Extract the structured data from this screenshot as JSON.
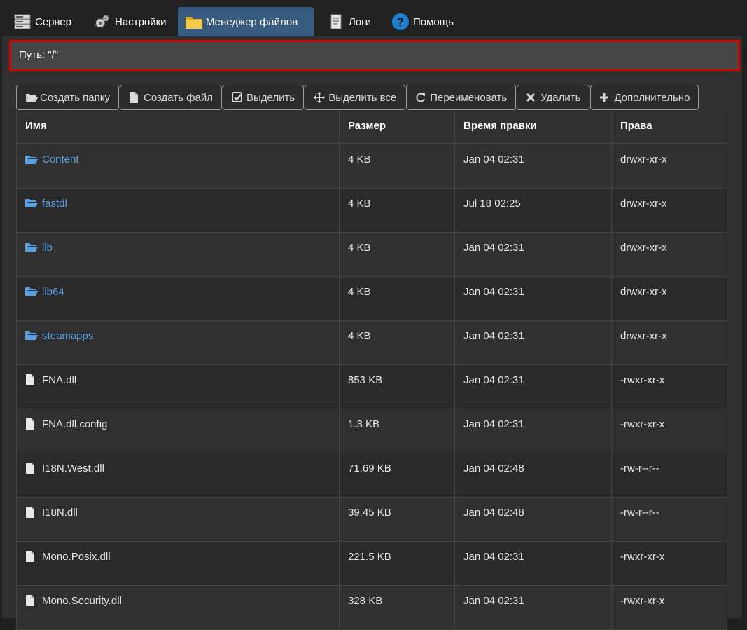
{
  "nav": {
    "tabs": [
      {
        "label": "Сервер",
        "icon": "server-icon",
        "active": false
      },
      {
        "label": "Настройки",
        "icon": "gears-icon",
        "active": false
      },
      {
        "label": "Менеджер файлов",
        "icon": "folder-icon",
        "active": true
      },
      {
        "label": "Логи",
        "icon": "log-document-icon",
        "active": false
      },
      {
        "label": "Помощь",
        "icon": "help-icon",
        "active": false
      }
    ]
  },
  "path": {
    "text": "Путь: \"/\""
  },
  "toolbar": {
    "buttons": [
      {
        "label": "Создать папку",
        "icon": "folder-open-icon"
      },
      {
        "label": "Создать файл",
        "icon": "file-icon"
      },
      {
        "label": "Выделить",
        "icon": "check-square-icon"
      },
      {
        "label": "Выделить все",
        "icon": "move-arrows-icon"
      },
      {
        "label": "Переименовать",
        "icon": "refresh-icon"
      },
      {
        "label": "Удалить",
        "icon": "close-icon"
      },
      {
        "label": "Дополнительно",
        "icon": "plus-icon"
      }
    ]
  },
  "table": {
    "headers": {
      "name": "Имя",
      "size": "Размер",
      "mtime": "Время правки",
      "perms": "Права"
    },
    "rows": [
      {
        "type": "folder",
        "name": "Content",
        "size": "4 KB",
        "mtime": "Jan 04 02:31",
        "perms": "drwxr-xr-x"
      },
      {
        "type": "folder",
        "name": "fastdl",
        "size": "4 KB",
        "mtime": "Jul 18 02:25",
        "perms": "drwxr-xr-x"
      },
      {
        "type": "folder",
        "name": "lib",
        "size": "4 KB",
        "mtime": "Jan 04 02:31",
        "perms": "drwxr-xr-x"
      },
      {
        "type": "folder",
        "name": "lib64",
        "size": "4 KB",
        "mtime": "Jan 04 02:31",
        "perms": "drwxr-xr-x"
      },
      {
        "type": "folder",
        "name": "steamapps",
        "size": "4 KB",
        "mtime": "Jan 04 02:31",
        "perms": "drwxr-xr-x"
      },
      {
        "type": "file",
        "name": "FNA.dll",
        "size": "853 KB",
        "mtime": "Jan 04 02:31",
        "perms": "-rwxr-xr-x"
      },
      {
        "type": "file",
        "name": "FNA.dll.config",
        "size": "1.3 KB",
        "mtime": "Jan 04 02:31",
        "perms": "-rwxr-xr-x"
      },
      {
        "type": "file",
        "name": "I18N.West.dll",
        "size": "71.69 KB",
        "mtime": "Jan 04 02:48",
        "perms": "-rw-r--r--"
      },
      {
        "type": "file",
        "name": "I18N.dll",
        "size": "39.45 KB",
        "mtime": "Jan 04 02:48",
        "perms": "-rw-r--r--"
      },
      {
        "type": "file",
        "name": "Mono.Posix.dll",
        "size": "221.5 KB",
        "mtime": "Jan 04 02:31",
        "perms": "-rwxr-xr-x"
      },
      {
        "type": "file",
        "name": "Mono.Security.dll",
        "size": "328 KB",
        "mtime": "Jan 04 02:31",
        "perms": "-rwxr-xr-x"
      }
    ]
  },
  "colors": {
    "accent": "#375a7f",
    "folder_link": "#5aa0e0",
    "path_border": "#d40000"
  }
}
